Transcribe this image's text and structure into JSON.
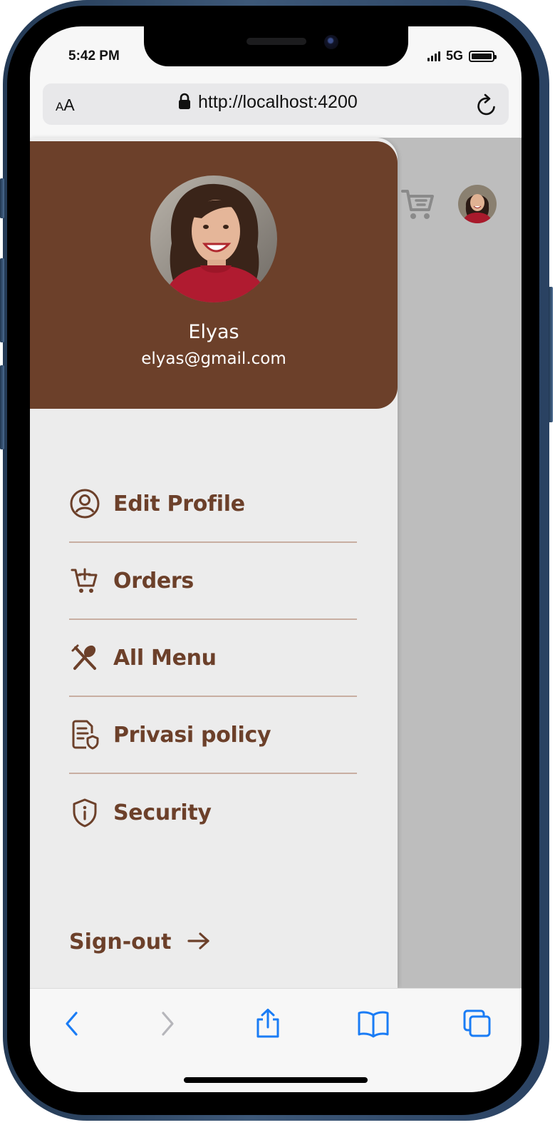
{
  "status_bar": {
    "time": "5:42 PM",
    "network": "5G"
  },
  "address_bar": {
    "text_size_small": "A",
    "text_size_large": "A",
    "url": "http://localhost:4200"
  },
  "drawer": {
    "user": {
      "name": "Elyas",
      "email": "elyas@gmail.com"
    },
    "menu": [
      {
        "label": "Edit Profile",
        "icon": "user-circle-icon"
      },
      {
        "label": "Orders",
        "icon": "cart-plus-icon"
      },
      {
        "label": "All Menu",
        "icon": "utensils-icon"
      },
      {
        "label": "Privasi policy",
        "icon": "document-shield-icon"
      },
      {
        "label": "Security",
        "icon": "shield-info-icon"
      }
    ],
    "signout_label": "Sign-out"
  },
  "colors": {
    "brand_brown": "#6c402a",
    "drawer_bg": "#ececec",
    "overlay": "#bdbdbd",
    "safari_blue": "#1a7cf5"
  }
}
